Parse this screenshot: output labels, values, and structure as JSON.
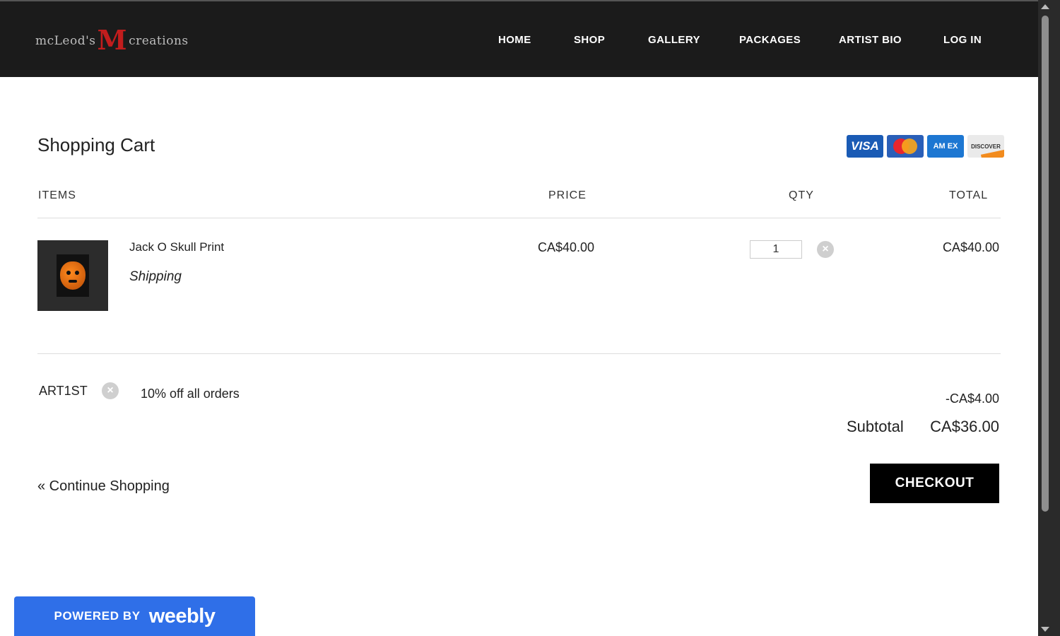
{
  "header": {
    "logo_text_pre": "mcLeod's",
    "logo_text_m": "M",
    "logo_text_post": "creations",
    "nav": [
      "HOME",
      "SHOP",
      "GALLERY",
      "PACKAGES",
      "ARTIST BIO",
      "LOG IN"
    ]
  },
  "cart": {
    "title": "Shopping Cart",
    "payment_cards": [
      "VISA",
      "mastercard",
      "AM EX",
      "DISCOVER"
    ],
    "columns": {
      "items": "ITEMS",
      "price": "PRICE",
      "qty": "QTY",
      "total": "TOTAL"
    },
    "items": [
      {
        "name": "Jack O Skull Print",
        "option": "Shipping",
        "price": "CA$40.00",
        "qty": "1",
        "total": "CA$40.00"
      }
    ],
    "coupon": {
      "code": "ART1ST",
      "description": "10% off all orders",
      "amount": "-CA$4.00"
    },
    "subtotal_label": "Subtotal",
    "subtotal_value": "CA$36.00",
    "continue_label": "« Continue Shopping",
    "checkout_label": "CHECKOUT"
  },
  "footer": {
    "powered_by": "POWERED BY",
    "brand": "weebly"
  },
  "colors": {
    "header_bg": "#1b1b1b",
    "checkout_bg": "#000000",
    "weebly_blue": "#2f6fe8"
  }
}
